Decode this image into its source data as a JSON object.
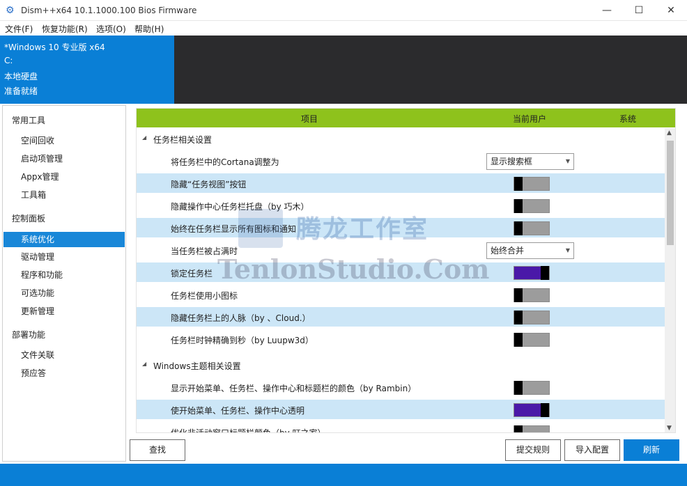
{
  "window": {
    "title": "Dism++x64 10.1.1000.100 Bios Firmware",
    "app_icon": "gear-icon",
    "controls": [
      "minimize-icon",
      "maximize-icon",
      "close-icon"
    ]
  },
  "menu": [
    "文件(F)",
    "恢复功能(R)",
    "选项(O)",
    "帮助(H)"
  ],
  "info": {
    "os": "*Windows 10 专业版 x64",
    "drive": "C:",
    "disk_type": "本地硬盘",
    "status": "准备就绪"
  },
  "nav": {
    "groups": [
      {
        "label": "常用工具",
        "items": [
          "空间回收",
          "启动项管理",
          "Appx管理",
          "工具箱"
        ]
      },
      {
        "label": "控制面板",
        "items": [
          "系统优化",
          "驱动管理",
          "程序和功能",
          "可选功能",
          "更新管理"
        ]
      },
      {
        "label": "部署功能",
        "items": [
          "文件关联",
          "预应答"
        ]
      }
    ],
    "active": "系统优化"
  },
  "grid": {
    "headers": {
      "item": "项目",
      "current_user": "当前用户",
      "system": "系统"
    },
    "sections": [
      {
        "label": "任务栏相关设置",
        "rows": [
          {
            "label": "将任务栏中的Cortana调整为",
            "control": "dropdown",
            "value": "显示搜索框"
          },
          {
            "label": "隐藏“任务视图”按钮",
            "control": "toggle",
            "on": false
          },
          {
            "label": "隐藏操作中心任务栏托盘（by 巧木）",
            "control": "toggle",
            "on": false
          },
          {
            "label": "始终在任务栏显示所有图标和通知",
            "control": "toggle",
            "on": false
          },
          {
            "label": "当任务栏被占满时",
            "control": "dropdown",
            "value": "始终合并"
          },
          {
            "label": "锁定任务栏",
            "control": "toggle",
            "on": true
          },
          {
            "label": "任务栏使用小图标",
            "control": "toggle",
            "on": false
          },
          {
            "label": "隐藏任务栏上的人脉（by 、Cloud.）",
            "control": "toggle",
            "on": false
          },
          {
            "label": "任务栏时钟精确到秒（by Luupw3d）",
            "control": "toggle",
            "on": false
          }
        ]
      },
      {
        "label": "Windows主题相关设置",
        "rows": [
          {
            "label": "显示开始菜单、任务栏、操作中心和标题栏的颜色（by Rambin）",
            "control": "toggle",
            "on": false
          },
          {
            "label": "使开始菜单、任务栏、操作中心透明",
            "control": "toggle",
            "on": true
          },
          {
            "label": "优化非活动窗口标题栏颜色（by 叮之家）",
            "control": "toggle",
            "on": false
          }
        ]
      }
    ]
  },
  "watermark": {
    "cn": "腾龙工作室",
    "en": "TenlonStudio.Com"
  },
  "buttons": {
    "find": "查找",
    "submit_rules": "提交规则",
    "import_config": "导入配置",
    "refresh": "刷新"
  },
  "colors": {
    "accent": "#0a7fd6",
    "header_green": "#8ec21c",
    "toggle_on": "#4a18a8",
    "row_alt": "#cce6f7"
  }
}
